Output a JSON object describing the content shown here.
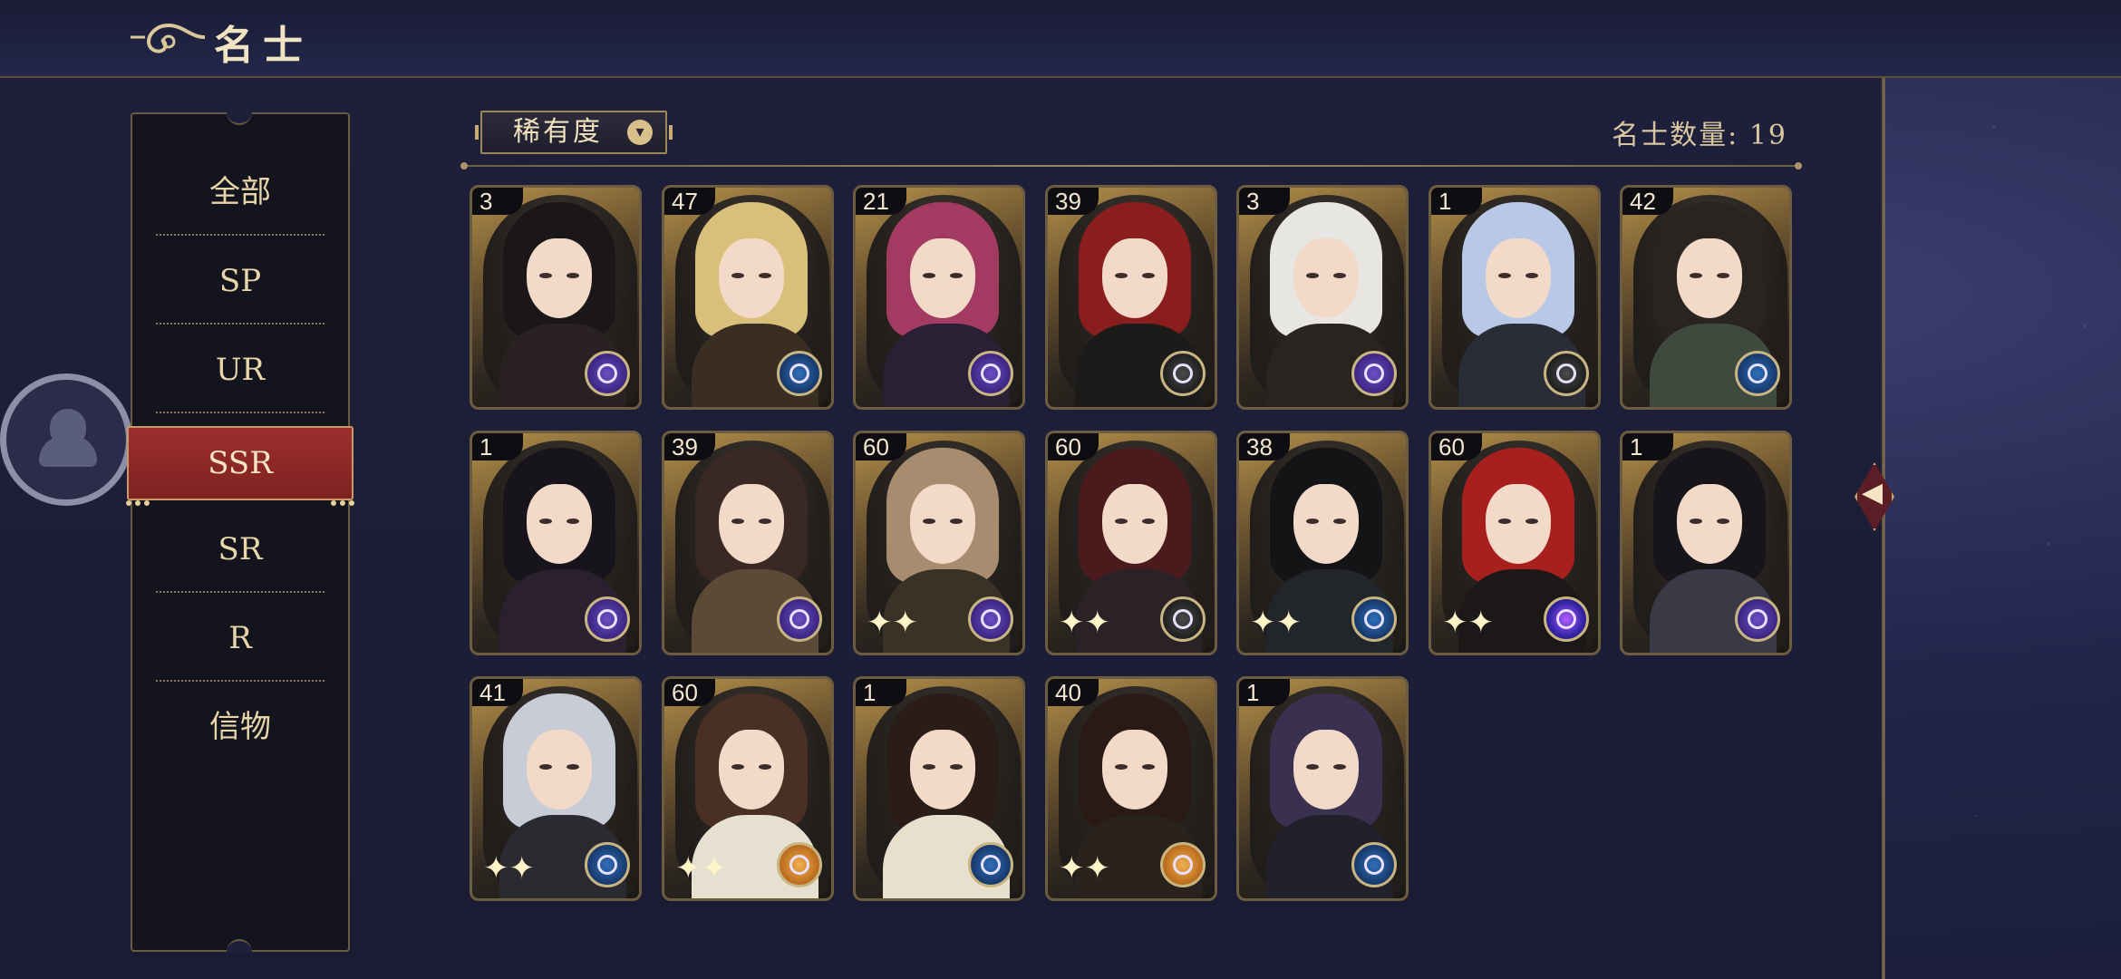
{
  "header": {
    "title": "名士"
  },
  "sidebar": {
    "items": [
      {
        "label": "全部"
      },
      {
        "label": "SP"
      },
      {
        "label": "UR"
      },
      {
        "label": "SSR"
      },
      {
        "label": "SR"
      },
      {
        "label": "R"
      },
      {
        "label": "信物"
      }
    ],
    "active": "SSR"
  },
  "filter": {
    "label": "稀有度"
  },
  "summary": {
    "count_label": "名士数量: 19"
  },
  "colors": {
    "accent_red": "#8e2a27",
    "gold": "#c9a670"
  },
  "cards": [
    {
      "level": "3",
      "emblem": "moon-emblem-icon",
      "emblem_color": "purple",
      "hair": "#1b1718",
      "outfit": "#2a2222"
    },
    {
      "level": "47",
      "emblem": "compass-emblem-icon",
      "emblem_color": "blue",
      "hair": "#d8c07a",
      "outfit": "#3a2e22"
    },
    {
      "level": "21",
      "emblem": "moon-emblem-icon",
      "emblem_color": "purple",
      "hair": "#a23a62",
      "outfit": "#2a2036"
    },
    {
      "level": "39",
      "emblem": "compass-emblem-icon",
      "emblem_color": "dark",
      "hair": "#8a1e1e",
      "outfit": "#1d1a1a"
    },
    {
      "level": "3",
      "emblem": "moon-emblem-icon",
      "emblem_color": "purple",
      "hair": "#e8e6e2",
      "outfit": "#2a2420"
    },
    {
      "level": "1",
      "emblem": "compass-emblem-icon",
      "emblem_color": "dark",
      "hair": "#b8c8e6",
      "outfit": "#2a2c36"
    },
    {
      "level": "42",
      "emblem": "compass-emblem-icon",
      "emblem_color": "blue",
      "hair": "#2a2420",
      "outfit": "#3e4a3e"
    },
    {
      "level": "1",
      "emblem": "moon-emblem-icon",
      "emblem_color": "purple",
      "hair": "#18141c",
      "outfit": "#2a2030"
    },
    {
      "level": "39",
      "emblem": "moon-emblem-icon",
      "emblem_color": "purple",
      "hair": "#3a2824",
      "outfit": "#5a4a36"
    },
    {
      "level": "60",
      "emblem": "moon-emblem-icon",
      "emblem_color": "purple",
      "hair": "#a88c70",
      "outfit": "#3a3226"
    },
    {
      "level": "60",
      "emblem": "compass-emblem-icon",
      "emblem_color": "dark",
      "hair": "#4a1a1c",
      "outfit": "#2a2226"
    },
    {
      "level": "38",
      "emblem": "compass-emblem-icon",
      "emblem_color": "blue",
      "hair": "#141416",
      "outfit": "#22262a"
    },
    {
      "level": "60",
      "emblem": "galaxy-emblem-icon",
      "emblem_color": "galaxy",
      "hair": "#a8201e",
      "outfit": "#1d1818"
    },
    {
      "level": "1",
      "emblem": "moon-emblem-icon",
      "emblem_color": "purple",
      "hair": "#18151a",
      "outfit": "#3a3a46"
    },
    {
      "level": "41",
      "emblem": "compass-emblem-icon",
      "emblem_color": "blue",
      "hair": "#c8ccd6",
      "outfit": "#2a2a30"
    },
    {
      "level": "60",
      "emblem": "orange-emblem-icon",
      "emblem_color": "orange",
      "hair": "#4a3024",
      "outfit": "#e6e0d0"
    },
    {
      "level": "1",
      "emblem": "compass-emblem-icon",
      "emblem_color": "blue",
      "hair": "#2a1c16",
      "outfit": "#e8e0cc"
    },
    {
      "level": "40",
      "emblem": "orange-emblem-icon",
      "emblem_color": "orange",
      "hair": "#2a1a16",
      "outfit": "#2a221c"
    },
    {
      "level": "1",
      "emblem": "compass-emblem-icon",
      "emblem_color": "blue",
      "hair": "#3a3050",
      "outfit": "#22202a"
    }
  ]
}
